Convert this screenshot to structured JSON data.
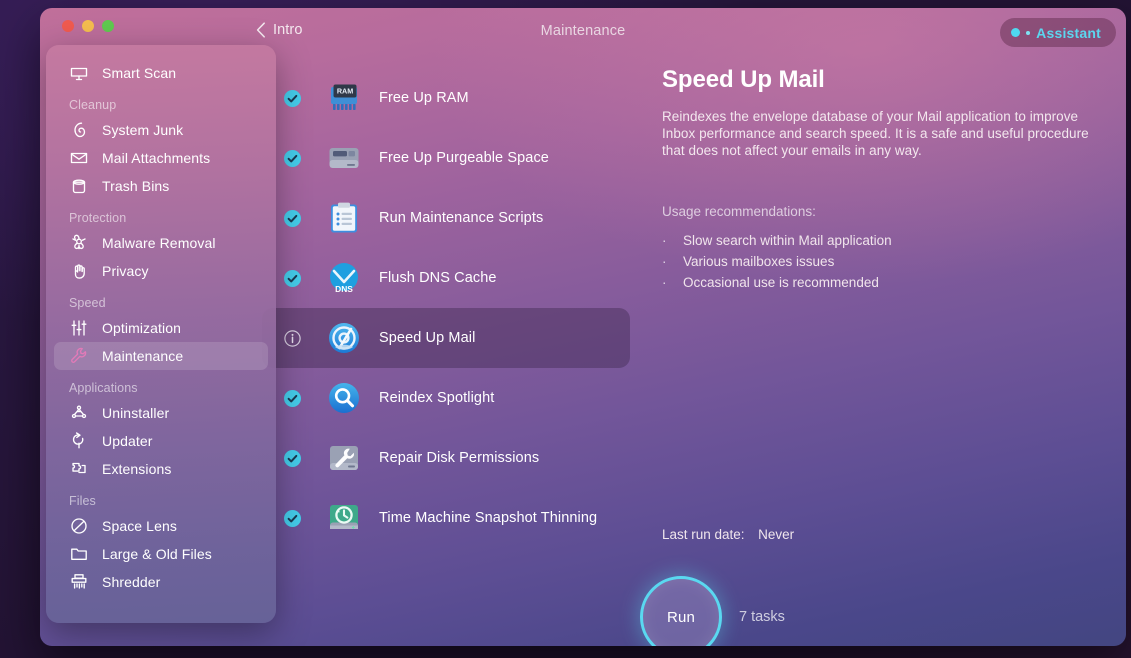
{
  "window": {
    "traffic_lights": [
      "close",
      "minimize",
      "zoom"
    ]
  },
  "header": {
    "back_label": "Intro",
    "title": "Maintenance",
    "assistant_label": "Assistant"
  },
  "sidebar": {
    "items": [
      {
        "type": "item",
        "label": "Smart Scan",
        "icon": "monitor-icon",
        "active": false
      },
      {
        "type": "section",
        "label": "Cleanup"
      },
      {
        "type": "item",
        "label": "System Junk",
        "icon": "broom-icon",
        "active": false
      },
      {
        "type": "item",
        "label": "Mail Attachments",
        "icon": "envelope-icon",
        "active": false
      },
      {
        "type": "item",
        "label": "Trash Bins",
        "icon": "trash-icon",
        "active": false
      },
      {
        "type": "section",
        "label": "Protection"
      },
      {
        "type": "item",
        "label": "Malware Removal",
        "icon": "biohazard-icon",
        "active": false
      },
      {
        "type": "item",
        "label": "Privacy",
        "icon": "hand-icon",
        "active": false
      },
      {
        "type": "section",
        "label": "Speed"
      },
      {
        "type": "item",
        "label": "Optimization",
        "icon": "sliders-icon",
        "active": false
      },
      {
        "type": "item",
        "label": "Maintenance",
        "icon": "wrench-icon",
        "active": true
      },
      {
        "type": "section",
        "label": "Applications"
      },
      {
        "type": "item",
        "label": "Uninstaller",
        "icon": "app-grid-icon",
        "active": false
      },
      {
        "type": "item",
        "label": "Updater",
        "icon": "refresh-arrow-icon",
        "active": false
      },
      {
        "type": "item",
        "label": "Extensions",
        "icon": "puzzle-piece-icon",
        "active": false
      },
      {
        "type": "section",
        "label": "Files"
      },
      {
        "type": "item",
        "label": "Space Lens",
        "icon": "circle-slash-icon",
        "active": false
      },
      {
        "type": "item",
        "label": "Large & Old Files",
        "icon": "folder-icon",
        "active": false
      },
      {
        "type": "item",
        "label": "Shredder",
        "icon": "shredder-icon",
        "active": false
      }
    ]
  },
  "tasks": [
    {
      "label": "Free Up RAM",
      "icon": "ram-chip-icon",
      "state": "checked",
      "selected": false
    },
    {
      "label": "Free Up Purgeable Space",
      "icon": "hard-drive-icon",
      "state": "checked",
      "selected": false
    },
    {
      "label": "Run Maintenance Scripts",
      "icon": "clipboard-icon",
      "state": "checked",
      "selected": false
    },
    {
      "label": "Flush DNS Cache",
      "icon": "dns-globe-icon",
      "state": "checked",
      "selected": false
    },
    {
      "label": "Speed Up Mail",
      "icon": "mail-speed-icon",
      "state": "info",
      "selected": true
    },
    {
      "label": "Reindex Spotlight",
      "icon": "spotlight-icon",
      "state": "checked",
      "selected": false
    },
    {
      "label": "Repair Disk Permissions",
      "icon": "disk-wrench-icon",
      "state": "checked",
      "selected": false
    },
    {
      "label": "Time Machine Snapshot Thinning",
      "icon": "time-machine-icon",
      "state": "checked",
      "selected": false
    }
  ],
  "detail": {
    "title": "Speed Up Mail",
    "description": "Reindexes the envelope database of your Mail application to improve Inbox performance and search speed. It is a safe and useful procedure that does not affect your emails in any way.",
    "usage_heading": "Usage recommendations:",
    "usage_items": [
      "Slow search within Mail application",
      "Various mailboxes issues",
      "Occasional use is recommended"
    ]
  },
  "footer": {
    "last_run_label": "Last run date:",
    "last_run_value": "Never",
    "run_label": "Run",
    "task_count": "7 tasks"
  },
  "colors": {
    "accent_cyan": "#5ad8f0",
    "active_nav": "#e27ab8",
    "window_top": "#c06f9a",
    "window_bottom": "#434681"
  }
}
